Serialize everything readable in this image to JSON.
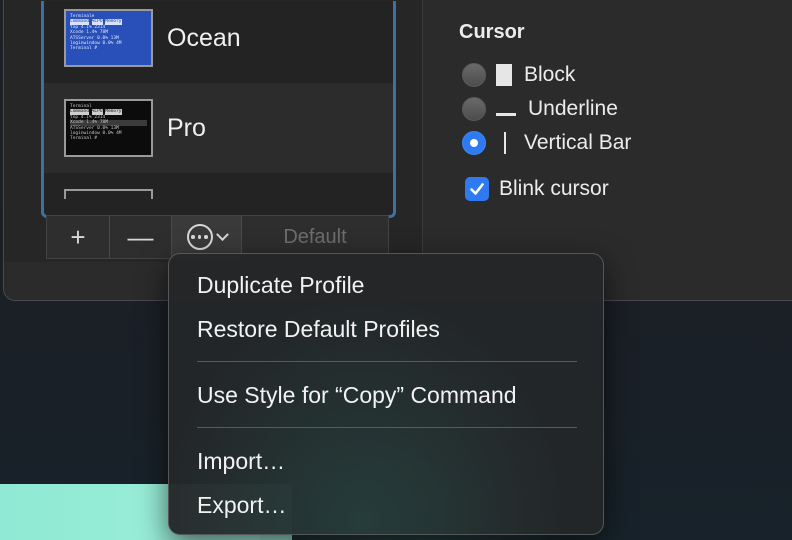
{
  "profiles": {
    "items": [
      {
        "name": "Ocean",
        "preview": {
          "title": "Terminale",
          "header": [
            "Command",
            "%CPU",
            "Memory"
          ],
          "rows": [
            [
              "top",
              "4.1%",
              "2314"
            ],
            [
              "Xcode",
              "1.4%",
              "78M"
            ],
            [
              "ATSServer",
              "0.0%",
              "13M"
            ],
            [
              "loginwindow",
              "0.0%",
              "4M"
            ]
          ],
          "prompt": "Terminal #"
        }
      },
      {
        "name": "Pro",
        "preview": {
          "title": "Terminal",
          "header": [
            "Command",
            "%CPU",
            "Memory"
          ],
          "rows": [
            [
              "top",
              "4.1%",
              "2314"
            ],
            [
              "Xcode",
              "1.4%",
              "78M"
            ],
            [
              "ATSServer",
              "0.0%",
              "13M"
            ],
            [
              "loginwindow",
              "0.0%",
              "4M"
            ]
          ],
          "prompt": "Terminal #"
        }
      }
    ]
  },
  "toolbar": {
    "add_label": "+",
    "remove_label": "—",
    "more_icon": "ellipsis-circle-icon",
    "default_label": "Default"
  },
  "cursor": {
    "title": "Cursor",
    "options": [
      {
        "label": "Block",
        "selected": false
      },
      {
        "label": "Underline",
        "selected": false
      },
      {
        "label": "Vertical Bar",
        "selected": true
      }
    ],
    "blink_label": "Blink cursor",
    "blink_checked": true
  },
  "menu": {
    "items": [
      "Duplicate Profile",
      "Restore Default Profiles",
      "Use Style for “Copy” Command",
      "Import…",
      "Export…"
    ]
  },
  "colors": {
    "accent": "#2f7af0",
    "selection_border": "#3f6fa3",
    "ocean_bg": "#2850b8"
  }
}
